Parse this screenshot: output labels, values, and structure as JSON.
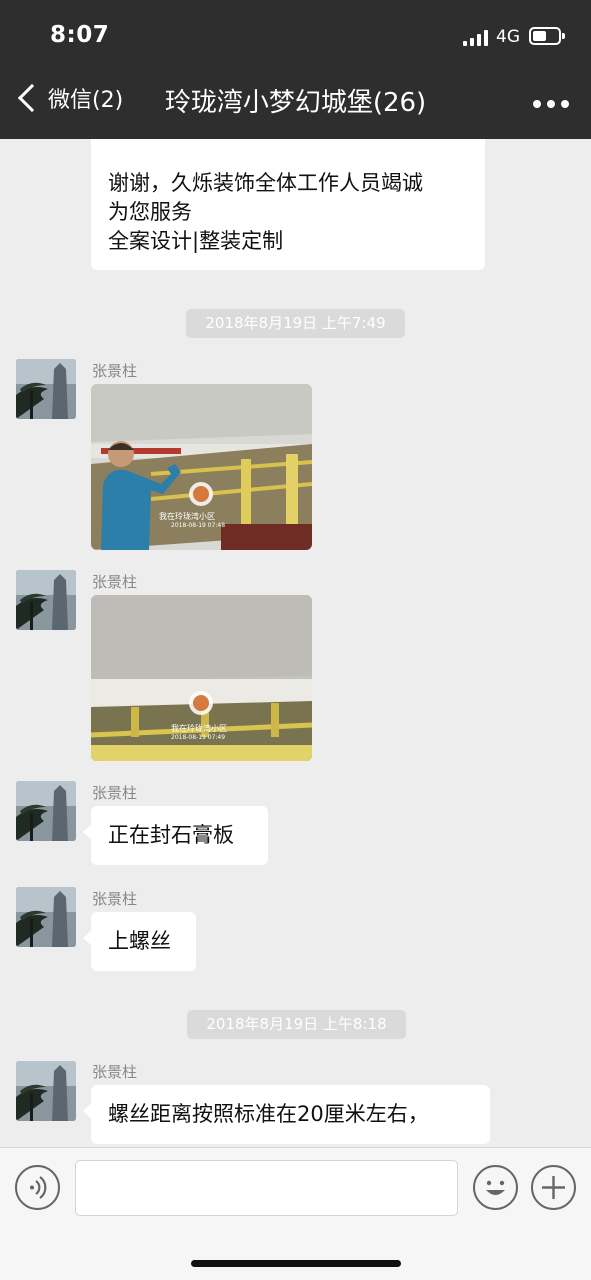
{
  "status_bar": {
    "time": "8:07",
    "network": "4G"
  },
  "nav": {
    "back_label": "微信(2)",
    "title": "玲珑湾小梦幻城堡(26)",
    "more_icon": "more-icon"
  },
  "colors": {
    "header_bg": "#2e2e2e",
    "chat_bg": "#ededed",
    "bubble_bg": "#ffffff",
    "time_pill_bg": "#dadada"
  },
  "messages": {
    "m0": {
      "lines": [
        "谢谢，久烁装饰全体工作人员竭诚",
        "为您服务",
        "全案设计|整装定制"
      ]
    },
    "t1": "2018年8月19日 上午7:49",
    "m1": {
      "sender": "张景柱",
      "watermark_text": "我在玲珑湾小区",
      "watermark_date": "2018-08-19 07:48"
    },
    "m2": {
      "sender": "张景柱",
      "watermark_text": "我在玲珑湾小区",
      "watermark_date": "2018-08-19 07:49"
    },
    "m3": {
      "sender": "张景柱",
      "text": "正在封石膏板"
    },
    "m4": {
      "sender": "张景柱",
      "text": "上螺丝"
    },
    "t2": "2018年8月19日 上午8:18",
    "m5": {
      "sender": "张景柱",
      "text": "螺丝距离按照标准在20厘米左右，"
    }
  },
  "input_bar": {
    "voice_icon": "voice-icon",
    "emoji_icon": "emoji-icon",
    "plus_icon": "plus-icon",
    "placeholder": ""
  }
}
